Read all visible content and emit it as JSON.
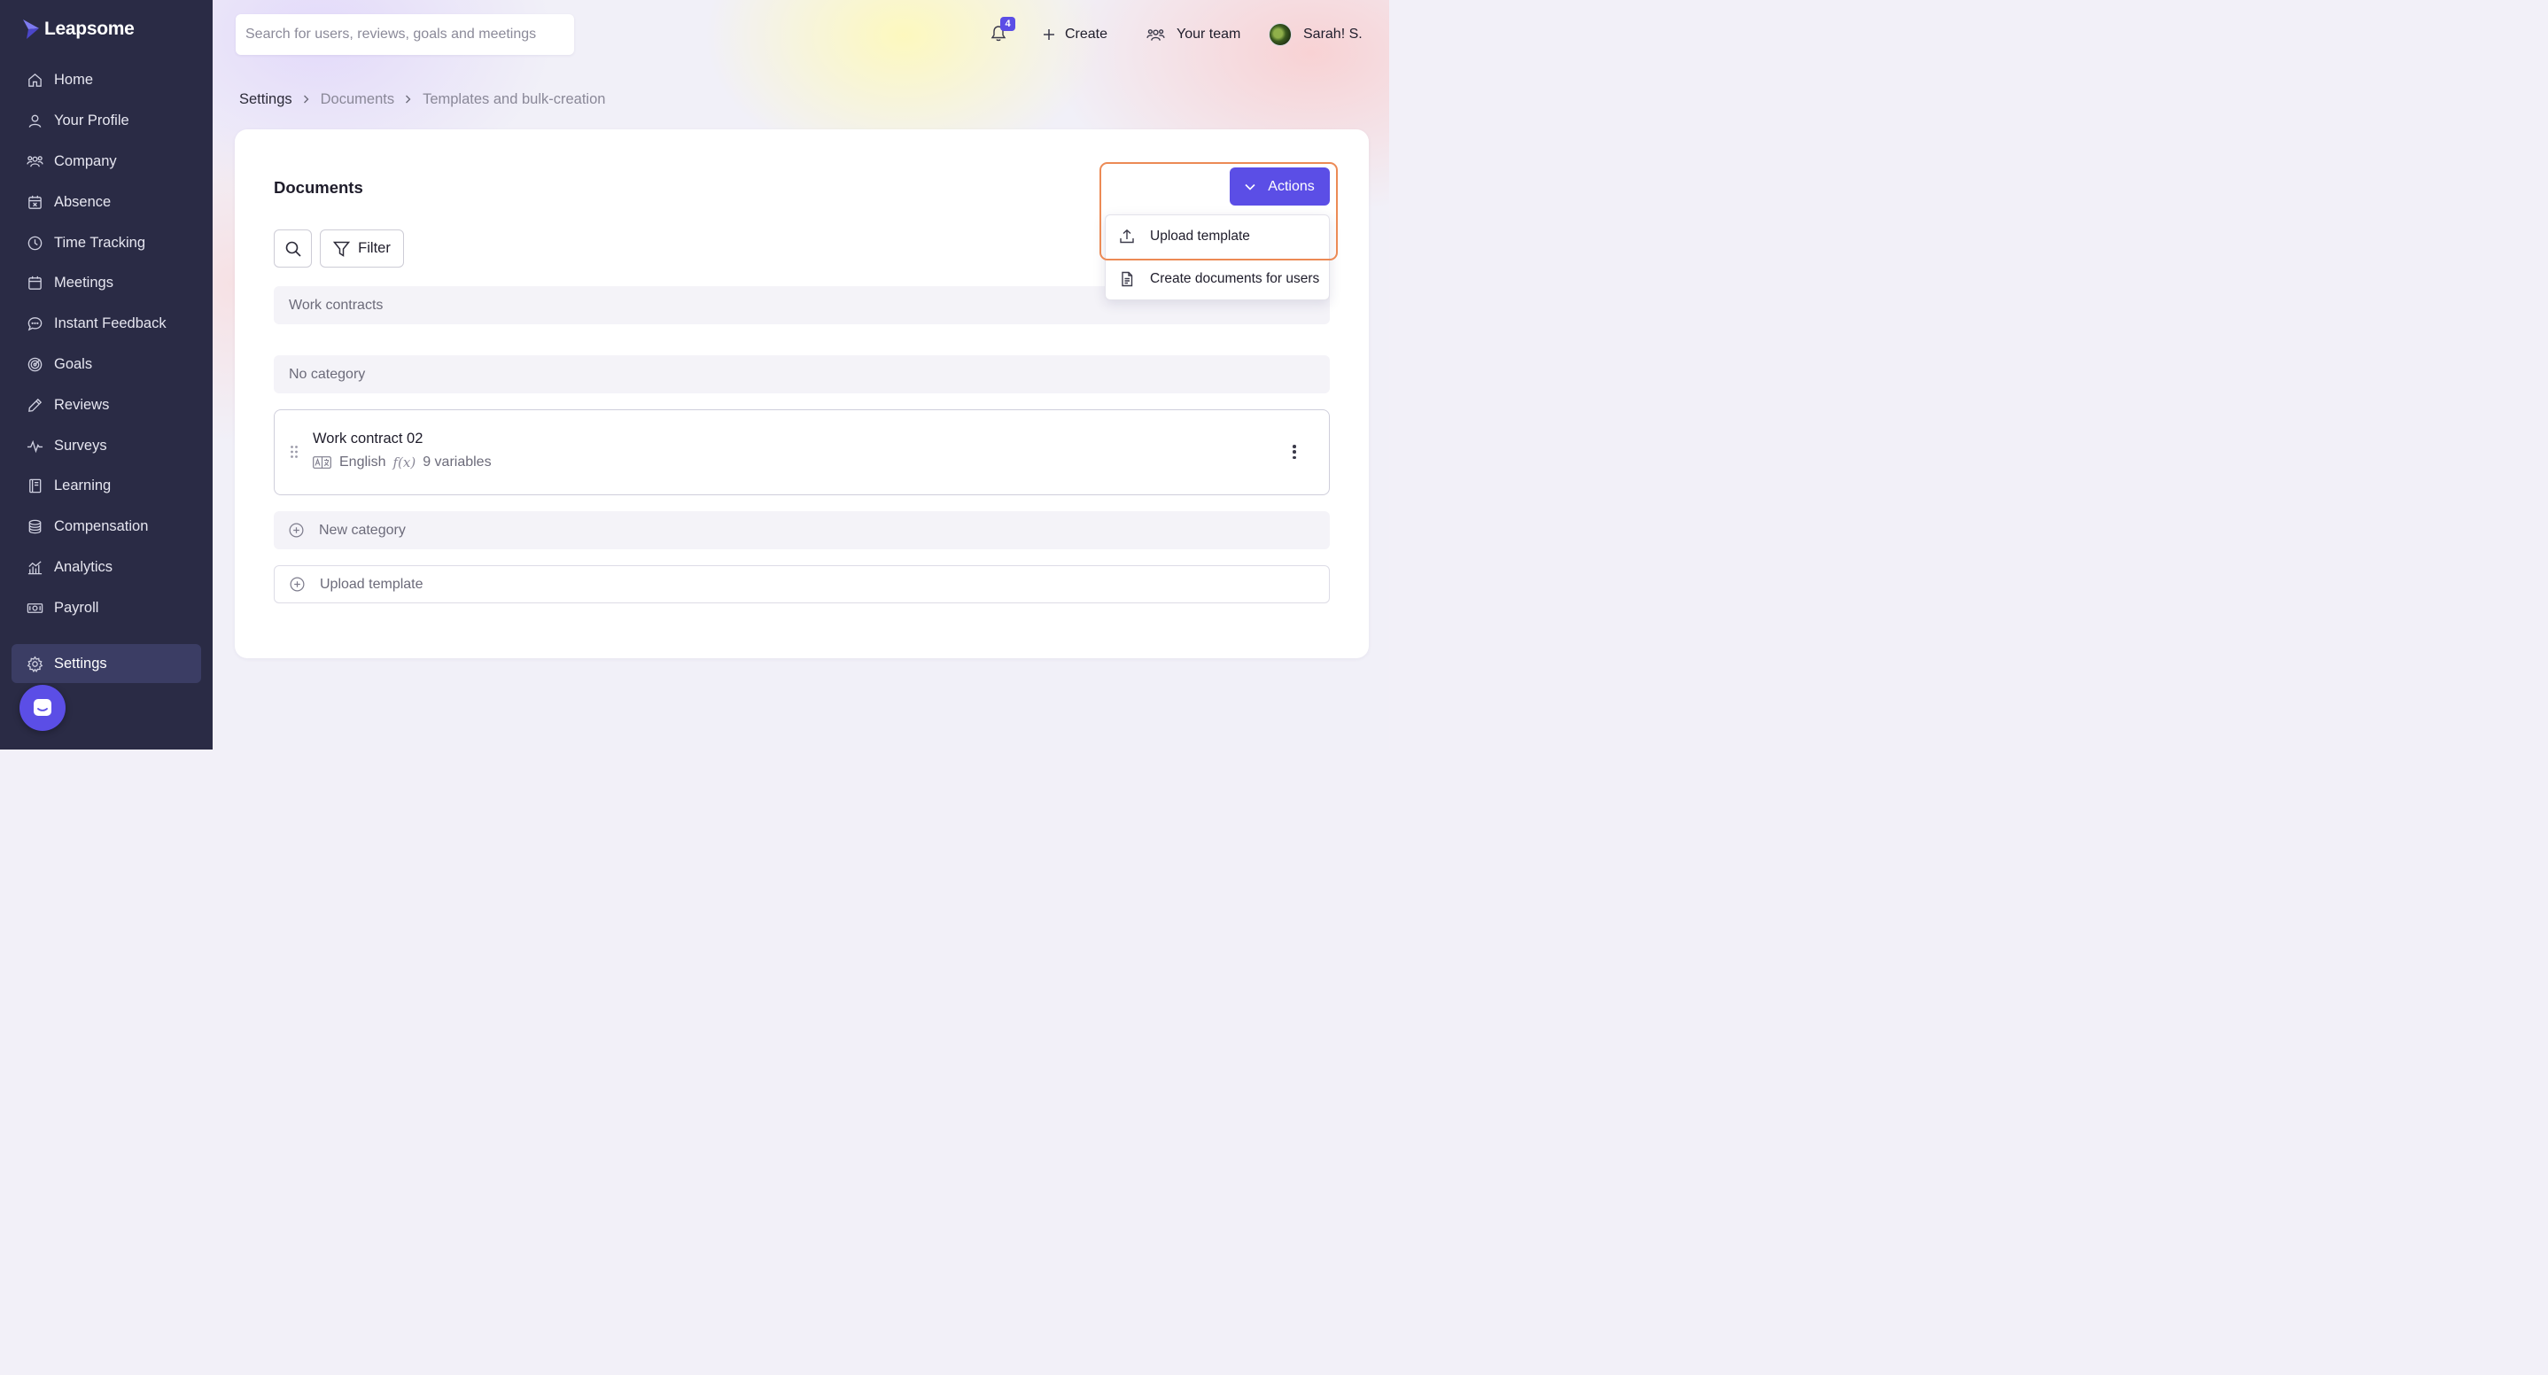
{
  "app": {
    "name": "Leapsome"
  },
  "sidebar": {
    "items": [
      {
        "label": "Home",
        "icon": "home-icon"
      },
      {
        "label": "Your Profile",
        "icon": "user-icon"
      },
      {
        "label": "Company",
        "icon": "company-icon"
      },
      {
        "label": "Absence",
        "icon": "calendar-x-icon"
      },
      {
        "label": "Time Tracking",
        "icon": "clock-icon"
      },
      {
        "label": "Meetings",
        "icon": "calendar-icon"
      },
      {
        "label": "Instant Feedback",
        "icon": "chat-icon"
      },
      {
        "label": "Goals",
        "icon": "target-icon"
      },
      {
        "label": "Reviews",
        "icon": "pencil-icon"
      },
      {
        "label": "Surveys",
        "icon": "pulse-icon"
      },
      {
        "label": "Learning",
        "icon": "book-icon"
      },
      {
        "label": "Compensation",
        "icon": "coins-icon"
      },
      {
        "label": "Analytics",
        "icon": "analytics-icon"
      },
      {
        "label": "Payroll",
        "icon": "money-icon"
      }
    ],
    "settings": {
      "label": "Settings",
      "icon": "gear-icon"
    }
  },
  "header": {
    "search_placeholder": "Search for users, reviews, goals and meetings",
    "notification_count": "4",
    "create_label": "Create",
    "team_label": "Your team",
    "user_name": "Sarah! S."
  },
  "breadcrumb": [
    "Settings",
    "Documents",
    "Templates and bulk-creation"
  ],
  "main": {
    "title": "Documents",
    "filter_label": "Filter",
    "actions_label": "Actions",
    "actions_menu": [
      {
        "label": "Upload template",
        "icon": "upload-icon"
      },
      {
        "label": "Create documents for users",
        "icon": "document-icon"
      }
    ],
    "categories": [
      {
        "label": "Work contracts"
      },
      {
        "label": "No category"
      }
    ],
    "documents": [
      {
        "name": "Work contract 02",
        "language": "English",
        "variables": "9 variables",
        "variables_icon": "f(x)"
      }
    ],
    "new_category_label": "New category",
    "upload_template_label": "Upload template"
  },
  "colors": {
    "sidebar_bg": "#2a2b45",
    "accent": "#5b4ee6",
    "highlight": "#ec8a55"
  }
}
